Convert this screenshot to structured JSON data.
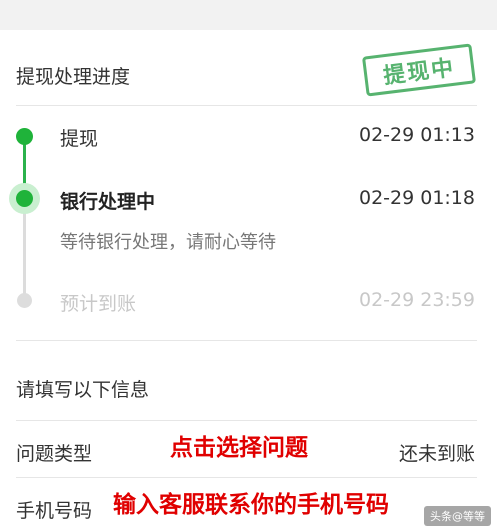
{
  "progress": {
    "title": "提现处理进度",
    "stamp": "提现中",
    "steps": [
      {
        "label": "提现",
        "time": "02-29 01:13"
      },
      {
        "label": "银行处理中",
        "time": "02-29 01:18",
        "desc": "等待银行处理，请耐心等待"
      },
      {
        "label": "预计到账",
        "time": "02-29 23:59"
      }
    ]
  },
  "form": {
    "title": "请填写以下信息",
    "issue_label": "问题类型",
    "issue_value": "还未到账",
    "phone_label": "手机号码"
  },
  "annotations": {
    "issue_hint": "点击选择问题",
    "phone_hint": "输入客服联系你的手机号码"
  },
  "watermark": "头条@等等",
  "colors": {
    "accent": "#1fb33a",
    "annotation": "#e00000"
  }
}
